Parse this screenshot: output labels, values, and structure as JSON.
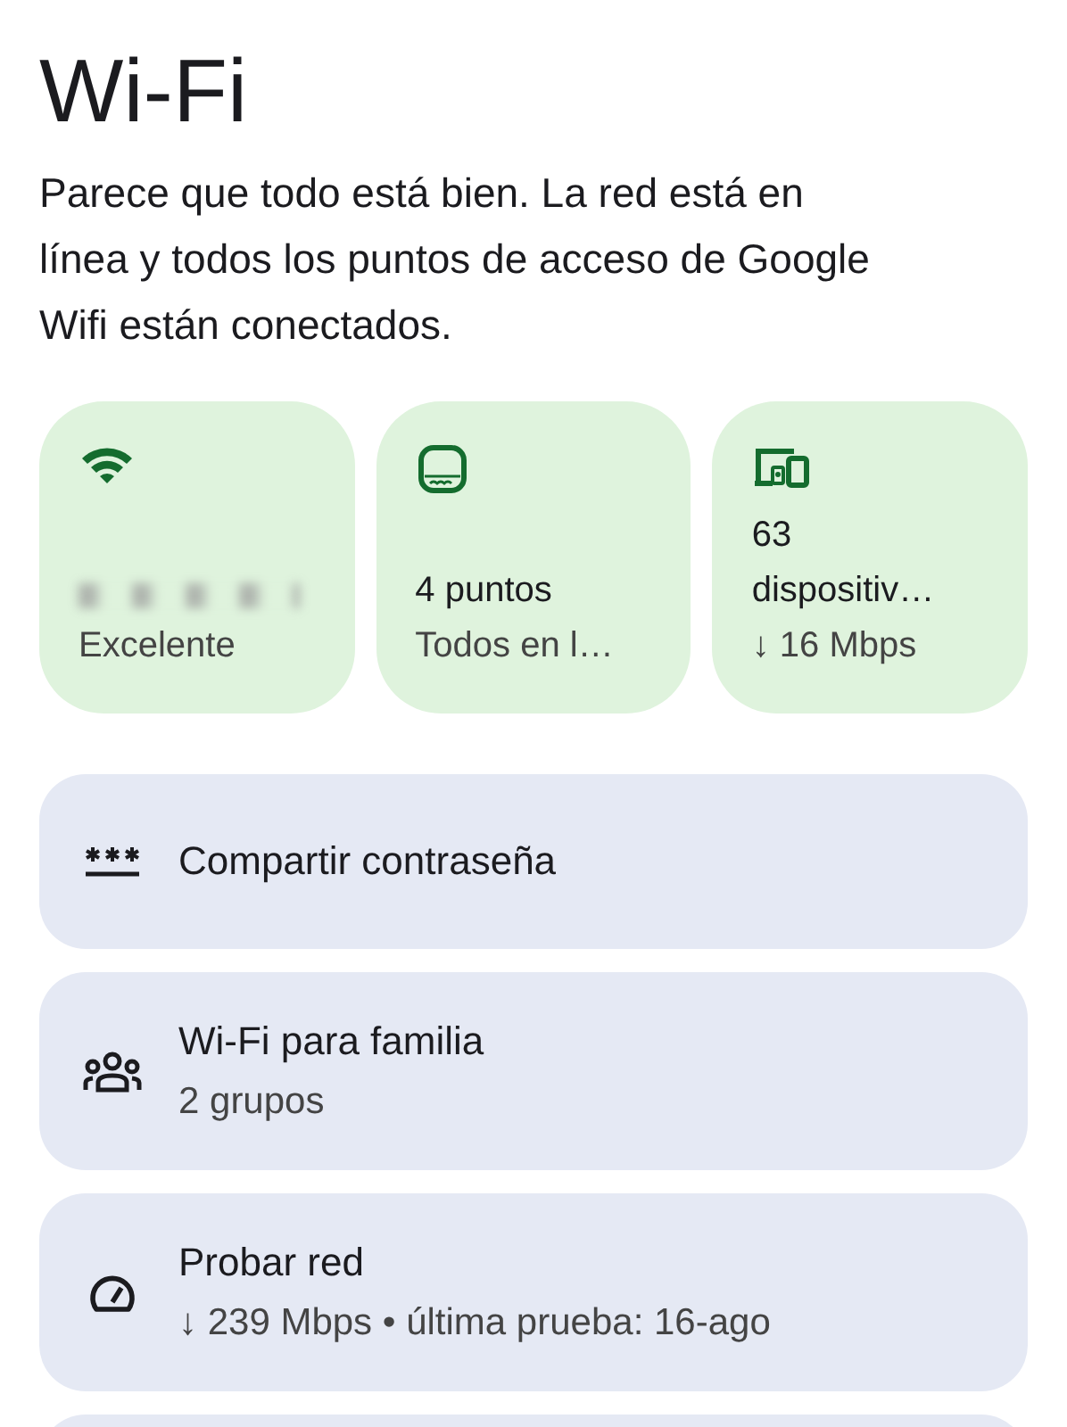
{
  "title": "Wi-Fi",
  "status_message": "Parece que todo está bien. La red está en línea y todos los puntos de acceso de Google Wifi están conectados.",
  "tiles": [
    {
      "kind": "network",
      "subtitle": "Excelente",
      "name_hidden": true
    },
    {
      "kind": "points",
      "title": "4 puntos",
      "subtitle": "Todos en l…"
    },
    {
      "kind": "devices",
      "title": "63 dispositiv…",
      "subtitle": "↓ 16 Mbps"
    }
  ],
  "actions": [
    {
      "kind": "password",
      "title": "Compartir contraseña"
    },
    {
      "kind": "family",
      "title": "Wi-Fi para familia",
      "subtitle": "2 grupos"
    },
    {
      "kind": "speed",
      "title": "Probar red",
      "subtitle": "↓ 239 Mbps • última prueba: 16-ago"
    }
  ]
}
